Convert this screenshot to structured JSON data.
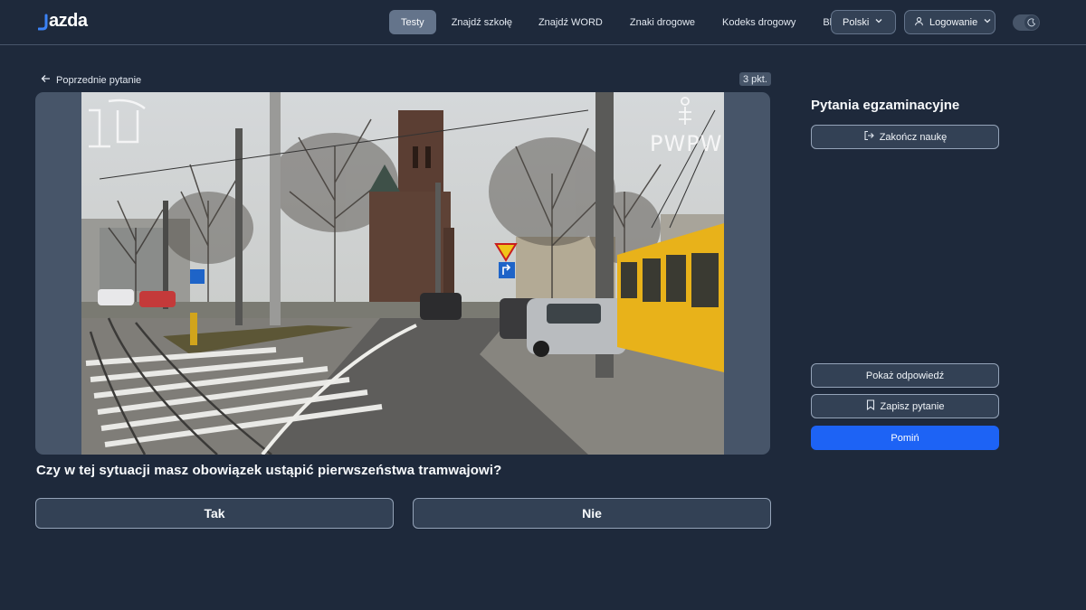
{
  "header": {
    "logo_text": "azda",
    "nav": [
      {
        "label": "Testy",
        "active": true
      },
      {
        "label": "Znajdź szkołę",
        "active": false
      },
      {
        "label": "Znajdź WORD",
        "active": false
      },
      {
        "label": "Znaki drogowe",
        "active": false
      },
      {
        "label": "Kodeks drogowy",
        "active": false
      },
      {
        "label": "Blog",
        "active": false
      }
    ],
    "language": "Polski",
    "login": "Logowanie",
    "theme_toggle_icon": "moon-icon"
  },
  "main": {
    "back_label": "Poprzednie pytanie",
    "points": "3 pkt.",
    "media_watermarks": [
      "PWPW"
    ],
    "question": "Czy w tej sytuacji masz obowiązek ustąpić pierwszeństwa tramwajowi?",
    "answers": [
      "Tak",
      "Nie"
    ]
  },
  "sidebar": {
    "title": "Pytania egzaminacyjne",
    "end_label": "Zakończ naukę",
    "show_label": "Pokaż odpowiedź",
    "save_label": "Zapisz pytanie",
    "skip_label": "Pomiń"
  },
  "colors": {
    "background": "#1e293b",
    "accent": "#1d63f5",
    "active_nav": "#64748b"
  }
}
